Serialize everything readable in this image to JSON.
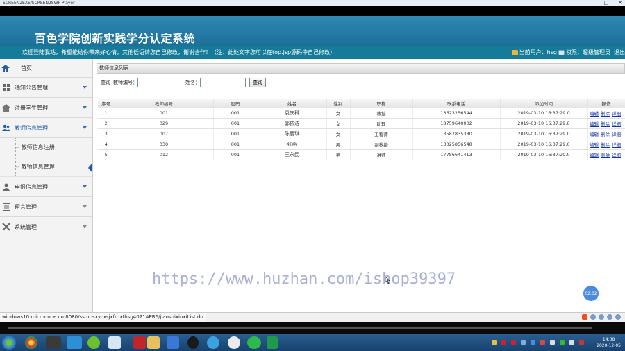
{
  "window": {
    "title": "SCREEN2EXE/SCREEN2SWF Player",
    "controls": [
      "—",
      "□",
      "✕"
    ]
  },
  "header": {
    "system_title": "百色学院创新实践学分认定系统"
  },
  "banner": {
    "welcome": "欢迎登陆我站，希望能给你带来好心情，其他话语请您自己修改，谢谢合作！（注：此处文字您可以在top.jsp源码中自己修改）",
    "user_label": "当前用户：hsg",
    "role_label": "权限：超级管理员",
    "logout": "退出"
  },
  "sidebar": {
    "home": "首页",
    "items": [
      {
        "label": "通知公告管理",
        "icon": "grid-icon"
      },
      {
        "label": "注册学生管理",
        "icon": "house-icon"
      },
      {
        "label": "教师信息管理",
        "icon": "users-icon",
        "active": true
      },
      {
        "label": "申报信息管理",
        "icon": "person-icon"
      },
      {
        "label": "留言管理",
        "icon": "note-icon"
      },
      {
        "label": "系统管理",
        "icon": "tools-icon"
      }
    ],
    "subitems": [
      {
        "label": "教师信息注册"
      },
      {
        "label": "教师信息管理",
        "active": true
      }
    ]
  },
  "panel": {
    "title": "教师信息列表"
  },
  "search": {
    "label_query": "查询",
    "label_teacher_no": "教师编号：",
    "label_name": "姓名：",
    "teacher_no_value": "",
    "name_value": "",
    "button": "查询"
  },
  "table": {
    "headers": [
      "序号",
      "教师编号",
      "密码",
      "姓名",
      "性别",
      "职称",
      "联系电话",
      "添加时间",
      "操作"
    ],
    "rows": [
      {
        "idx": "1",
        "no": "001",
        "pwd": "001",
        "name": "袁庆科",
        "sex": "女",
        "title": "教授",
        "phone": "13623256544",
        "time": "2019-03-10 16:37:29.0"
      },
      {
        "idx": "2",
        "no": "029",
        "pwd": "001",
        "name": "郭依洁",
        "sex": "女",
        "title": "助理",
        "phone": "18759640002",
        "time": "2019-03-10 16:37:29.0"
      },
      {
        "idx": "3",
        "no": "007",
        "pwd": "001",
        "name": "陈丽琪",
        "sex": "女",
        "title": "工程师",
        "phone": "13587835380",
        "time": "2019-03-10 16:37:29.0"
      },
      {
        "idx": "4",
        "no": "030",
        "pwd": "001",
        "name": "张燕",
        "sex": "男",
        "title": "副教授",
        "phone": "13025856548",
        "time": "2019-03-10 16:37:29.0"
      },
      {
        "idx": "5",
        "no": "012",
        "pwd": "001",
        "name": "王永民",
        "sex": "男",
        "title": "讲师",
        "phone": "17786641413",
        "time": "2019-03-10 16:37:29.0"
      }
    ],
    "actions": [
      "编辑",
      "删除",
      "详细"
    ]
  },
  "watermark": "https://www.huzhan.com/ishop39397",
  "float_badge": "02:02",
  "statusbar": {
    "url": "windows10.microdone.cn:8080/ssmbsxycxsjxfrdxthsg4021AEB6/jiaoshixinxiList.do"
  },
  "taskbar": {
    "time": "14:08",
    "date": "2020-12-05"
  },
  "colors": {
    "header": "#1c6f98",
    "banner": "#147b98",
    "link": "#1033a6",
    "active_marker": "#1e5aa8"
  }
}
